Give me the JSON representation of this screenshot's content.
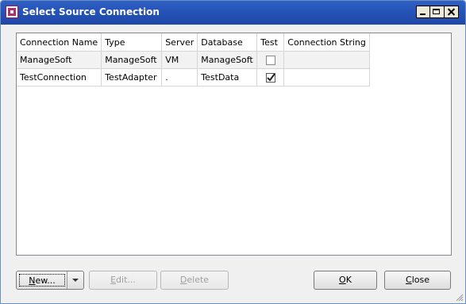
{
  "window": {
    "title": "Select Source Connection"
  },
  "table": {
    "columns": [
      "Connection Name",
      "Type",
      "Server",
      "Database",
      "Test",
      "Connection String"
    ],
    "rows": [
      {
        "name": "ManageSoft",
        "type": "ManageSoft",
        "server": "VM",
        "database": "ManageSoft",
        "test": false,
        "connection_string": ""
      },
      {
        "name": "TestConnection",
        "type": "TestAdapter",
        "server": ".",
        "database": "TestData",
        "test": true,
        "connection_string": ""
      }
    ]
  },
  "buttons": {
    "new": {
      "mnemonic": "N",
      "rest": "ew..."
    },
    "edit": {
      "mnemonic": "E",
      "rest": "dit..."
    },
    "delete": {
      "mnemonic": "D",
      "rest": "elete"
    },
    "ok": {
      "mnemonic": "O",
      "rest": "K"
    },
    "close": {
      "mnemonic": "C",
      "rest": "lose"
    }
  },
  "icons": {
    "app": "app-icon",
    "minimize": "minimize-icon",
    "maximize": "maximize-icon",
    "close": "close-icon",
    "dropdown": "chevron-down-icon",
    "checkbox": "checkbox-icon",
    "resize": "resize-grip-icon"
  },
  "colors": {
    "titlebar": "#2653b8",
    "dialog_bg": "#f0f0f0",
    "row_alt": "#f2f2f2"
  }
}
